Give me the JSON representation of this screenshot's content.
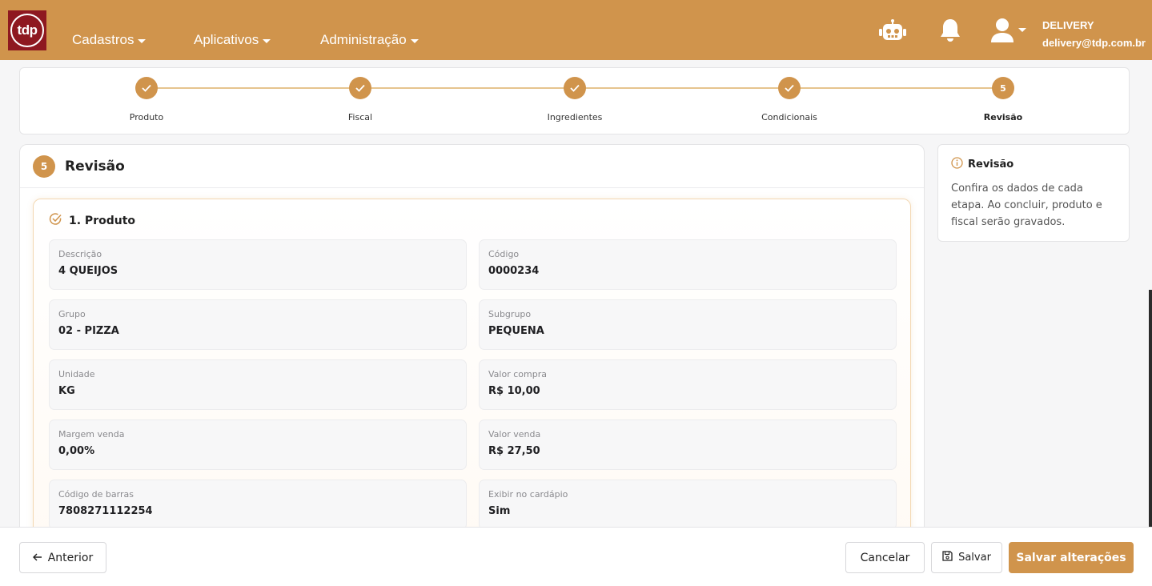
{
  "header": {
    "logo_text": "tdp",
    "nav": [
      {
        "label": "Cadastros"
      },
      {
        "label": "Aplicativos"
      },
      {
        "label": "Administração"
      }
    ],
    "user": {
      "name": "DELIVERY",
      "email": "delivery@tdp.com.br"
    },
    "icons": [
      "robot-icon",
      "bell-icon",
      "user-icon"
    ]
  },
  "stepper": {
    "steps": [
      {
        "label": "Produto",
        "status": "done"
      },
      {
        "label": "Fiscal",
        "status": "done"
      },
      {
        "label": "Ingredientes",
        "status": "done"
      },
      {
        "label": "Condicionais",
        "status": "done"
      },
      {
        "label": "Revisão",
        "status": "active",
        "number": "5"
      }
    ]
  },
  "main": {
    "step_number": "5",
    "title": "Revisão",
    "section": {
      "title": "1. Produto",
      "fields": [
        {
          "label": "Descrição",
          "value": "4 QUEIJOS"
        },
        {
          "label": "Código",
          "value": "0000234"
        },
        {
          "label": "Grupo",
          "value": "02 - PIZZA"
        },
        {
          "label": "Subgrupo",
          "value": "PEQUENA"
        },
        {
          "label": "Unidade",
          "value": "KG"
        },
        {
          "label": "Valor compra",
          "value": "R$ 10,00"
        },
        {
          "label": "Margem venda",
          "value": "0,00%"
        },
        {
          "label": "Valor venda",
          "value": "R$ 27,50"
        },
        {
          "label": "Código de barras",
          "value": "7808271112254"
        },
        {
          "label": "Exibir no cardápio",
          "value": "Sim"
        }
      ]
    }
  },
  "side": {
    "title": "Revisão",
    "text": "Confira os dados de cada etapa. Ao concluir, produto e fiscal serão gravados."
  },
  "footer": {
    "prev_label": "Anterior",
    "cancel_label": "Cancelar",
    "save_label": "Salvar",
    "save_changes_label": "Salvar alterações"
  },
  "colors": {
    "accent": "#d0944c",
    "logo_bg": "#8e1820"
  }
}
